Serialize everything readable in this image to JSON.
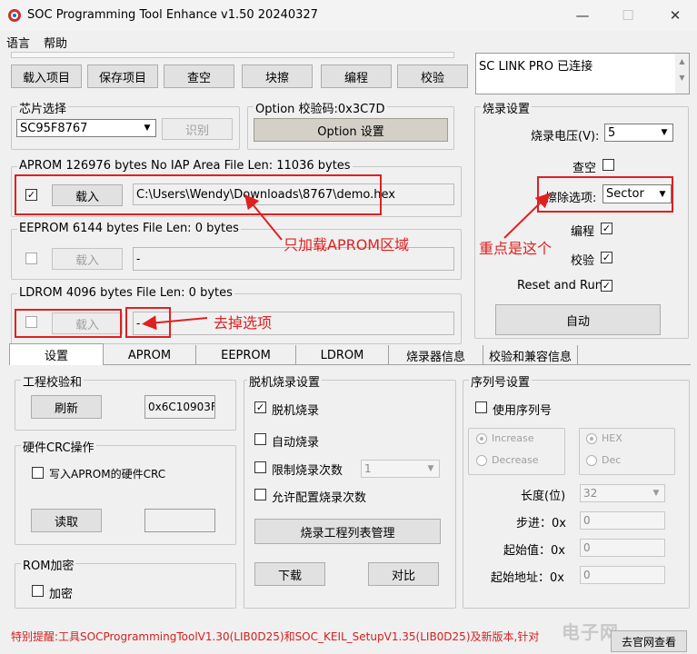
{
  "window": {
    "title": "SOC Programming Tool Enhance v1.50 20240327",
    "minimize": "—",
    "maximize": "☐",
    "close": "✕"
  },
  "menu": {
    "language": "语言",
    "help": "帮助"
  },
  "toolbar": {
    "load_project": "载入项目",
    "save_project": "保存项目",
    "blank_check": "查空",
    "block_erase": "块擦",
    "program": "编程",
    "verify": "校验"
  },
  "status_box": {
    "text": "SC LINK PRO 已连接"
  },
  "chip_select": {
    "label": "芯片选择",
    "value": "SC95F8767",
    "identify": "识别"
  },
  "option": {
    "label": "Option  校验码:0x3C7D",
    "button": "Option 设置"
  },
  "aprom": {
    "label": "APROM 126976 bytes  No IAP Area    File Len: 11036 bytes",
    "checked": "☑",
    "load": "载入",
    "path": "C:\\Users\\Wendy\\Downloads\\8767\\demo.hex"
  },
  "eeprom": {
    "label": "EEPROM 6144 bytes    File Len: 0 bytes",
    "load": "载入",
    "path": "-"
  },
  "ldrom": {
    "label": "LDROM 4096 bytes    File Len: 0 bytes",
    "load": "载入",
    "path": "-"
  },
  "annotations": {
    "only_aprom": "只加载APROM区域",
    "remove_option": "去掉选项",
    "key_point": "重点是这个"
  },
  "burn_settings": {
    "label": "烧录设置",
    "voltage_label": "烧录电压(V):",
    "voltage_value": "5",
    "blank_label": "查空",
    "erase_label": "擦除选项:",
    "erase_value": "Sector",
    "program_label": "编程",
    "verify_label": "校验",
    "reset_run_label": "Reset and Run",
    "auto_button": "自动",
    "check": "✓"
  },
  "tabs": [
    "设置",
    "APROM",
    "EEPROM",
    "LDROM",
    "烧录器信息",
    "校验和兼容信息"
  ],
  "checksum": {
    "label": "工程校验和",
    "refresh": "刷新",
    "value": "0x6C10903F"
  },
  "hw_crc": {
    "label": "硬件CRC操作",
    "write_label": "写入APROM的硬件CRC",
    "read": "读取"
  },
  "rom_encrypt": {
    "label": "ROM加密",
    "encrypt": "加密"
  },
  "offline": {
    "label": "脱机烧录设置",
    "offline_burn": "脱机烧录",
    "auto_burn": "自动烧录",
    "limit_count": "限制烧录次数",
    "limit_value": "1",
    "allow_config": "允许配置烧录次数",
    "project_list": "烧录工程列表管理",
    "download": "下载",
    "compare": "对比",
    "check": "✓"
  },
  "serial": {
    "label": "序列号设置",
    "use_serial": "使用序列号",
    "increase": "Increase",
    "decrease": "Decrease",
    "hex": "HEX",
    "dec": "Dec",
    "length_label": "长度(位)",
    "length_value": "32",
    "step_label": "步进：0x",
    "step_value": "0",
    "start_label": "起始值：0x",
    "start_value": "0",
    "addr_label": "起始地址：0x",
    "addr_value": "0"
  },
  "footer": {
    "notice": "特别提醒:工具SOCProgrammingToolV1.30(LIB0D25)和SOC_KEIL_SetupV1.35(LIB0D25)及新版本,针对",
    "official_link": "去官网查看",
    "watermark": "电子网"
  },
  "colors": {
    "annotation_red": "#e02020",
    "notice_red": "#d42020"
  }
}
